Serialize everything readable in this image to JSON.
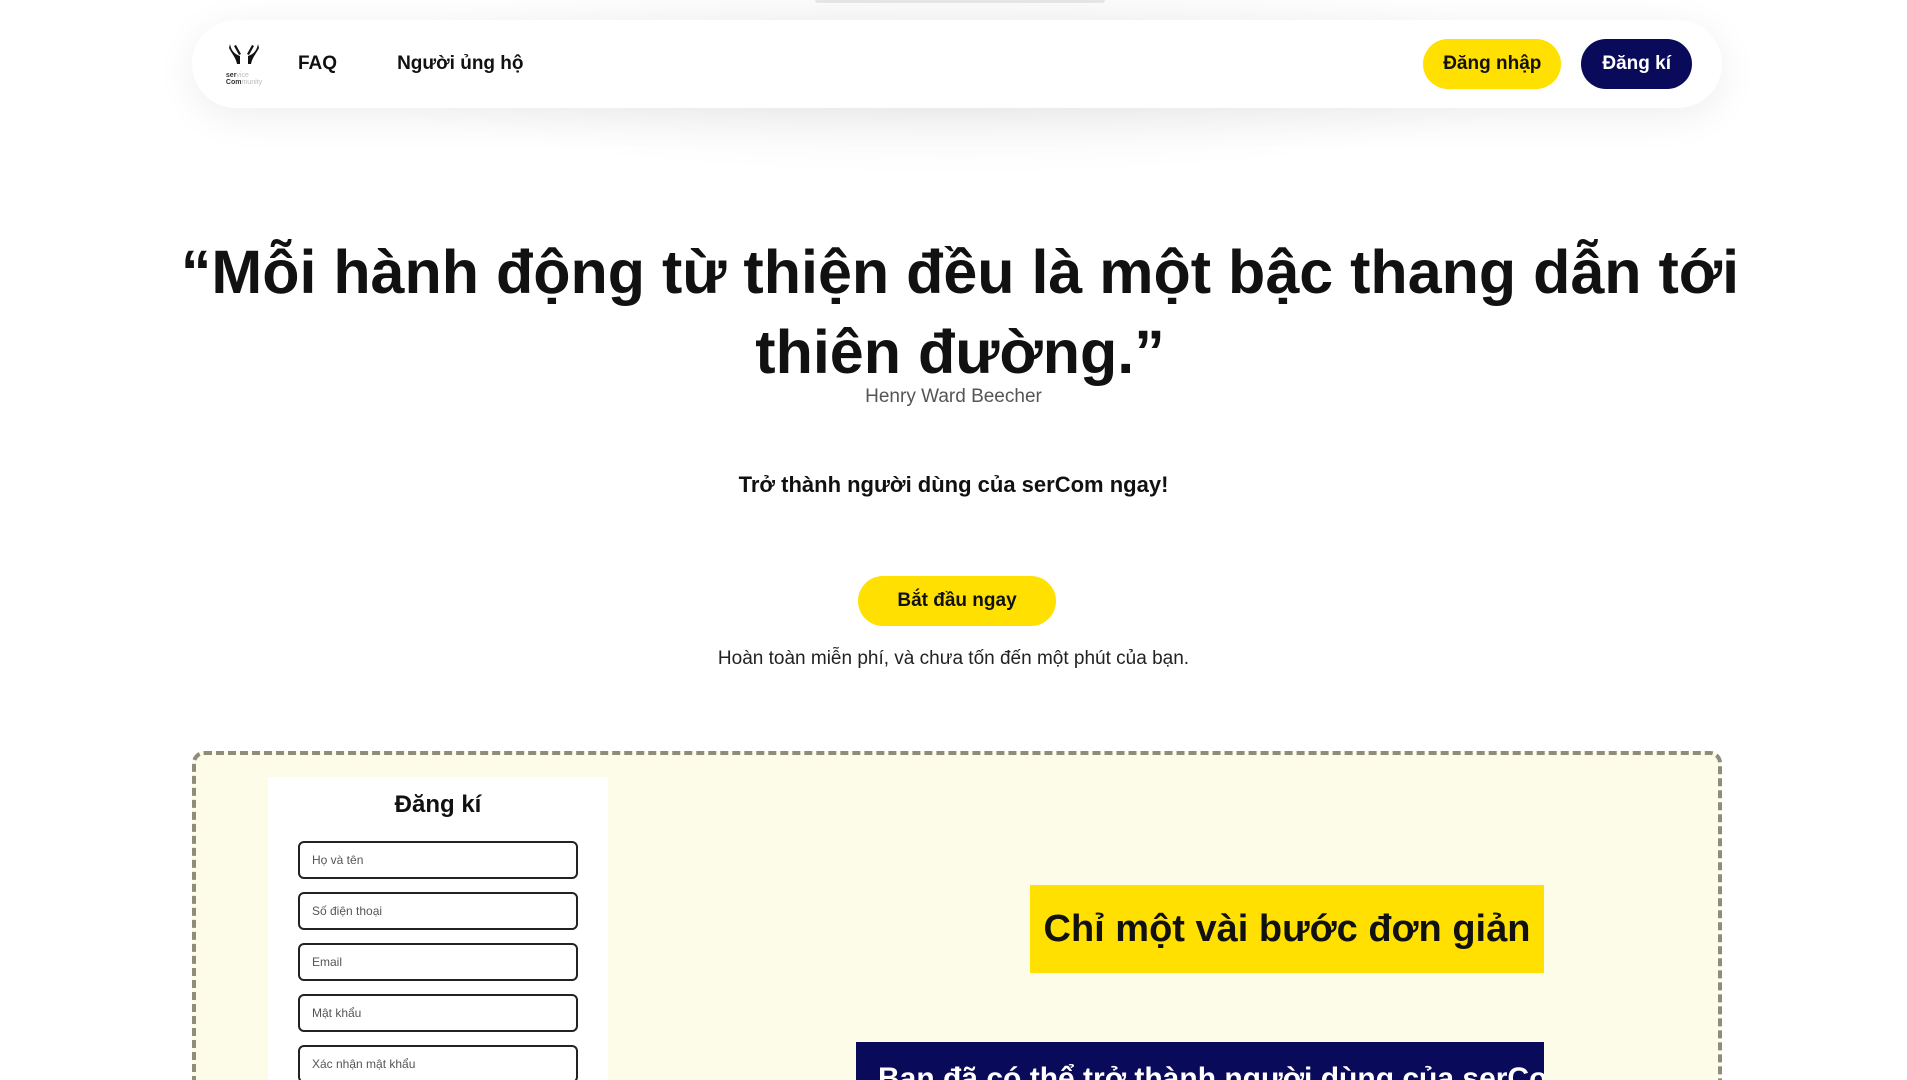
{
  "header": {
    "logo": {
      "icon": "raised-hands-icon",
      "word_top": "ser",
      "word_top_faint": "vice",
      "word_bottom": "Com",
      "word_bottom_faint": "munity"
    },
    "nav": [
      {
        "label": "FAQ"
      },
      {
        "label": "Người ủng hộ"
      }
    ],
    "login_label": "Đăng nhập",
    "register_label": "Đăng kí"
  },
  "hero": {
    "quote": "“Mỗi hành động từ thiện đều là một bậc thang dẫn tới thiên đường.”",
    "author": "Henry Ward Beecher",
    "cta_heading": "Trở thành người dùng của serCom ngay!",
    "cta_button": "Bắt đầu ngay",
    "cta_note": "Hoàn toàn miễn phí, và chưa tốn đến một phút của bạn."
  },
  "signup_form": {
    "title": "Đăng kí",
    "fields": [
      {
        "placeholder": "Họ và tên"
      },
      {
        "placeholder": "Số điện thoại"
      },
      {
        "placeholder": "Email"
      },
      {
        "placeholder": "Mật khẩu"
      },
      {
        "placeholder": "Xác nhận mật khẩu"
      }
    ]
  },
  "steps": {
    "title": "Chỉ một vài bước đơn giản",
    "banner": "Bạn đã có thể trở thành người dùng của serCom"
  },
  "colors": {
    "accent_yellow": "#ffe000",
    "navy": "#0a0a5a",
    "section_bg": "#fdfce8"
  }
}
